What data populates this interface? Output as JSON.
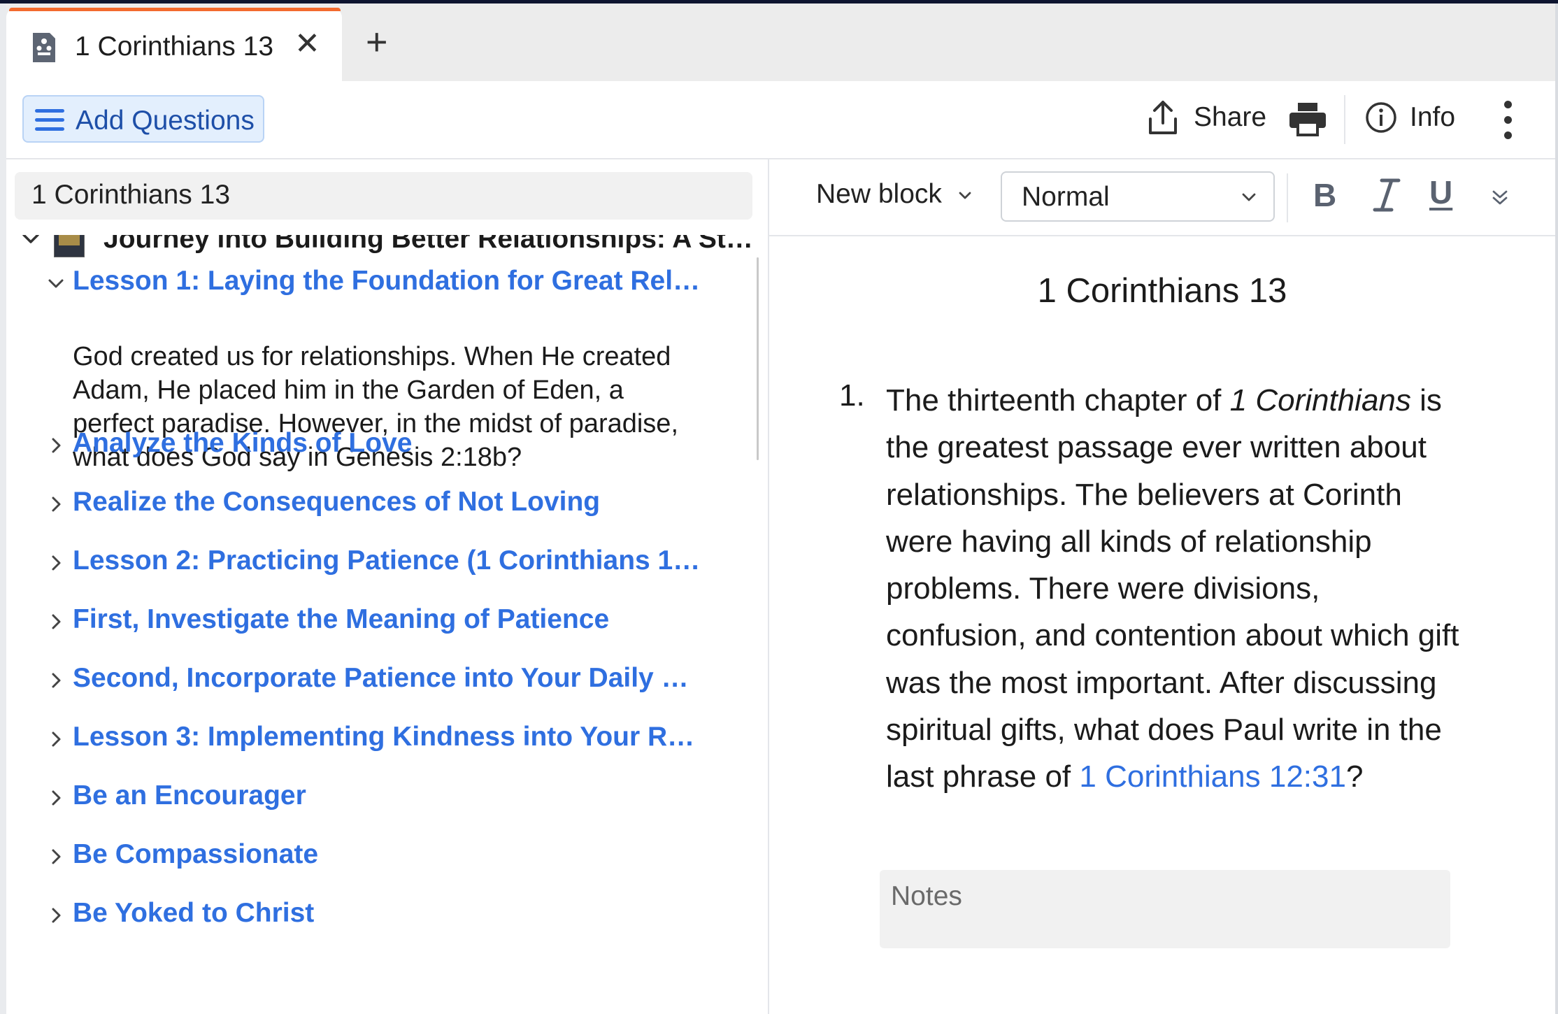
{
  "tab": {
    "title": "1 Corinthians 13",
    "close_glyph": "✕",
    "add_glyph": "+"
  },
  "toolbar": {
    "add_questions_label": "Add Questions",
    "share_label": "Share",
    "info_label": "Info"
  },
  "left_pane": {
    "search_value": "1 Corinthians 13",
    "root_title": "Journey into Building Better Relationships: A St…",
    "items": [
      {
        "label": "Lesson 1: Laying the Foundation for Great Rel…",
        "expanded": true
      },
      {
        "label": "Analyze the Kinds of Love",
        "expanded": false
      },
      {
        "label": "Realize the Consequences of Not Loving",
        "expanded": false
      },
      {
        "label": "Lesson 2: Practicing Patience (1 Corinthians 1…",
        "expanded": false
      },
      {
        "label": "First, Investigate the Meaning of Patience",
        "expanded": false
      },
      {
        "label": "Second, Incorporate Patience into Your Daily …",
        "expanded": false
      },
      {
        "label": "Lesson 3: Implementing Kindness into Your R…",
        "expanded": false
      },
      {
        "label": "Be an Encourager",
        "expanded": false
      },
      {
        "label": "Be Compassionate",
        "expanded": false
      },
      {
        "label": "Be Yoked to Christ",
        "expanded": false
      }
    ],
    "expanded_question": "God created us for relationships. When He created Adam, He placed him in the Garden of Eden, a perfect paradise. However, in the midst of paradise, what does God say in Genesis 2:18b?"
  },
  "editor": {
    "new_block_label": "New block",
    "style_value": "Normal",
    "bold_label": "B",
    "underline_label": "U",
    "doc_title": "1 Corinthians 13",
    "question": {
      "number": "1.",
      "text_before": "The thirteenth chapter of ",
      "book_italic": "1 Corinthians",
      "text_middle": " is the greatest passage ever written about relationships. The believers at Corinth were having all kinds of relationship problems. There were divisions, confusion, and contention about which gift was the most important. After discussing spiritual gifts, what does Paul write in the last phrase of ",
      "reference": "1 Corinthians 12:31",
      "text_after": "?"
    },
    "notes_placeholder": "Notes"
  },
  "colors": {
    "accent_blue": "#2f6fe0",
    "tab_accent": "#f26a2e",
    "add_questions_bg": "#e3effd"
  },
  "icons": [
    "document-icon",
    "close-icon",
    "plus-icon",
    "menu-icon",
    "share-icon",
    "print-icon",
    "info-icon",
    "more-vertical-icon",
    "chevron-down-icon",
    "chevron-right-icon",
    "italic-icon",
    "double-chevron-down-icon"
  ]
}
